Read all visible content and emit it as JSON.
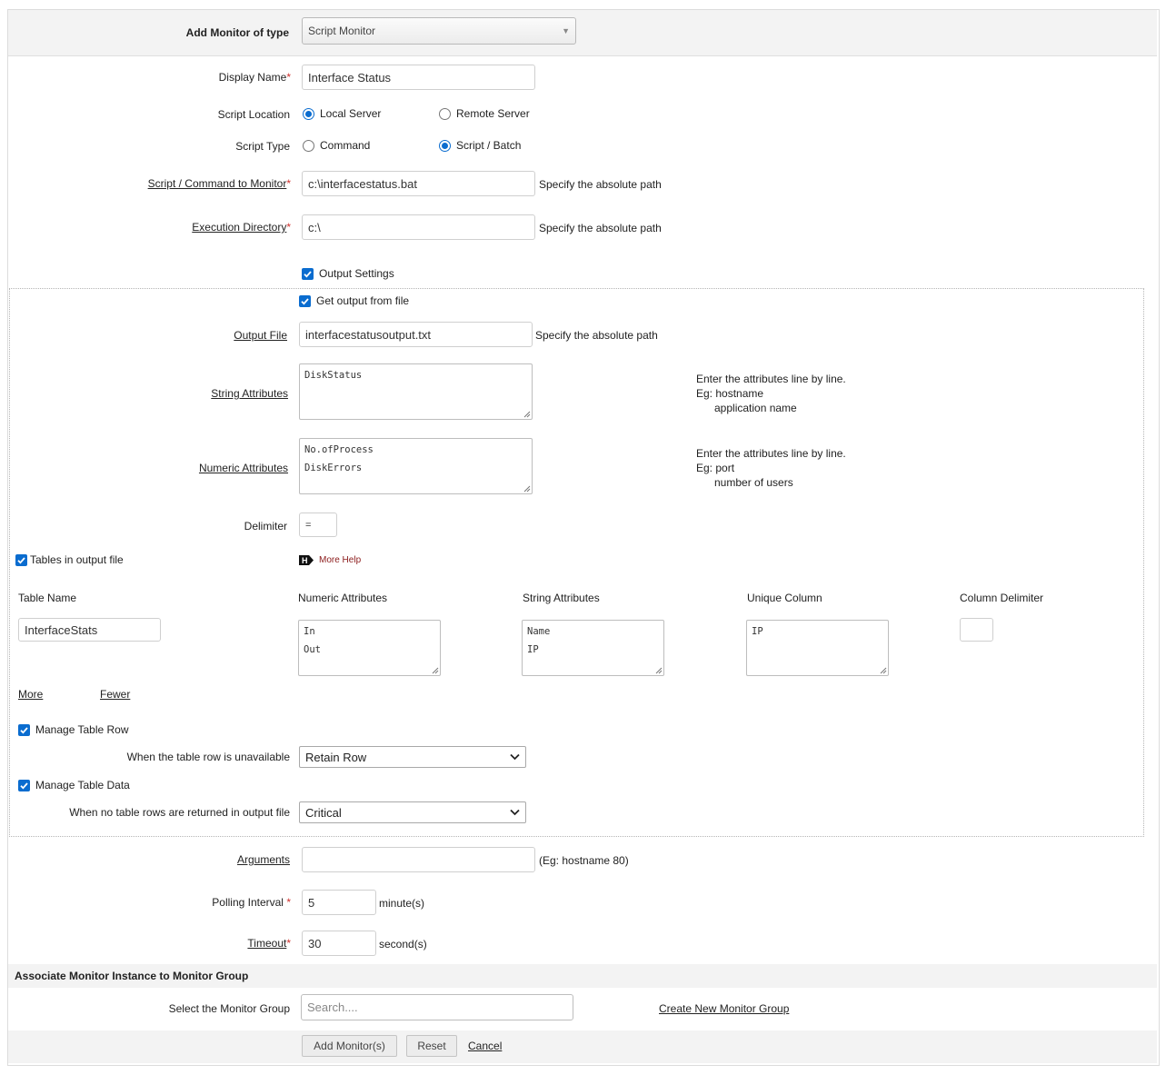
{
  "header": {
    "add_monitor_label": "Add Monitor of type",
    "monitor_type": "Script Monitor"
  },
  "form": {
    "display_name": {
      "label": "Display Name",
      "value": "Interface Status"
    },
    "script_location": {
      "label": "Script Location",
      "options": [
        "Local Server",
        "Remote Server"
      ],
      "selected": "Local Server"
    },
    "script_type": {
      "label": "Script Type",
      "options": [
        "Command",
        "Script / Batch"
      ],
      "selected": "Script / Batch"
    },
    "script_command": {
      "label": "Script / Command to Monitor",
      "value": "c:\\interfacestatus.bat",
      "hint": "Specify the absolute path"
    },
    "execution_directory": {
      "label": "Execution Directory",
      "value": "c:\\",
      "hint": "Specify the absolute path"
    },
    "output_settings": {
      "label": "Output Settings",
      "checked": true
    }
  },
  "output": {
    "get_output_from_file": {
      "label": "Get output from file",
      "checked": true
    },
    "output_file": {
      "label": "Output File",
      "value": "interfacestatusoutput.txt",
      "hint": "Specify the absolute path"
    },
    "string_attributes": {
      "label": "String Attributes",
      "lines": [
        "DiskStatus"
      ],
      "help": [
        "Enter the attributes line by line.",
        "Eg: hostname",
        "application name"
      ]
    },
    "numeric_attributes": {
      "label": "Numeric Attributes",
      "lines": [
        "No.ofProcess",
        "DiskErrors"
      ],
      "help": [
        "Enter the attributes line by line.",
        "Eg: port",
        "number of users"
      ]
    },
    "delimiter": {
      "label": "Delimiter",
      "value": "="
    },
    "tables_in_output": {
      "label": "Tables in output file",
      "checked": true
    },
    "more_help": "More Help",
    "table_columns": [
      "Table Name",
      "Numeric Attributes",
      "String Attributes",
      "Unique Column",
      "Column Delimiter"
    ],
    "table_row": {
      "table_name": "InterfaceStats",
      "numeric_attributes": [
        "In",
        "Out"
      ],
      "string_attributes": [
        "Name",
        "IP"
      ],
      "unique_column": [
        "IP"
      ],
      "column_delimiter": ""
    },
    "more_link": "More",
    "fewer_link": "Fewer",
    "manage_table_row": {
      "label": "Manage Table Row",
      "checked": true
    },
    "row_unavailable": {
      "label": "When the table row is unavailable",
      "value": "Retain Row"
    },
    "manage_table_data": {
      "label": "Manage Table Data",
      "checked": true
    },
    "no_rows_returned": {
      "label": "When no table rows are returned in output file",
      "value": "Critical"
    }
  },
  "params": {
    "arguments": {
      "label": "Arguments",
      "value": "",
      "hint": "(Eg: hostname 80)"
    },
    "polling_interval": {
      "label": "Polling Interval",
      "value": "5",
      "unit": "minute(s)"
    },
    "timeout": {
      "label": "Timeout",
      "value": "30",
      "unit": "second(s)"
    }
  },
  "group": {
    "section_title": "Associate Monitor Instance to Monitor Group",
    "select_label": "Select the Monitor Group",
    "search_placeholder": "Search....",
    "create_link": "Create New Monitor Group"
  },
  "actions": {
    "add": "Add Monitor(s)",
    "reset": "Reset",
    "cancel": "Cancel"
  },
  "required_marker": "*"
}
